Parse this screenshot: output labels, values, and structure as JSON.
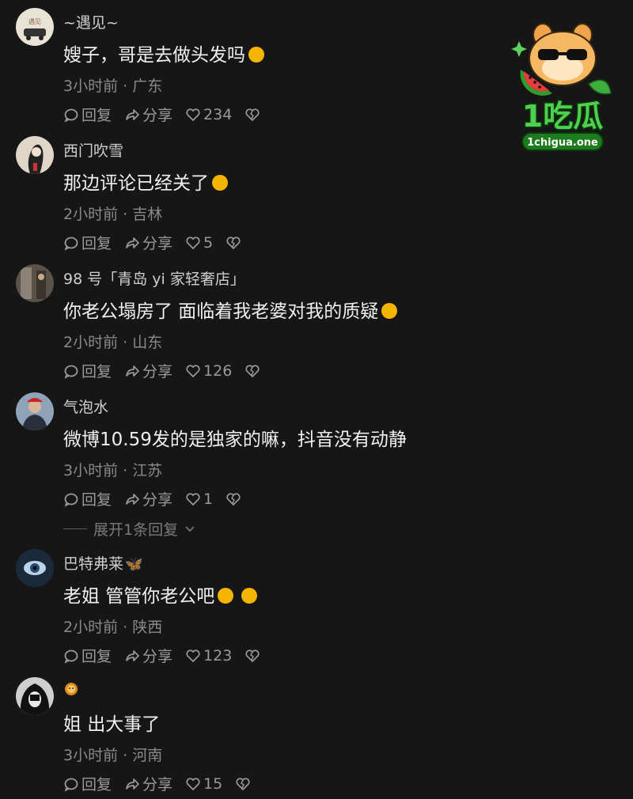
{
  "watermark": {
    "brand": "1吃瓜",
    "url": "1chigua.one"
  },
  "comments": [
    {
      "username": "~遇见~",
      "text": "嫂子，哥是去做头发吗",
      "meta": "3小时前 · 广东",
      "reply": "回复",
      "share": "分享",
      "likes": "234",
      "emoji": "laugh-cry"
    },
    {
      "username": "西门吹雪",
      "text": "那边评论已经关了",
      "meta": "2小时前 · 吉林",
      "reply": "回复",
      "share": "分享",
      "likes": "5",
      "emoji": "smile"
    },
    {
      "username": "98 号「青岛 yi 家轻奢店」",
      "text": "你老公塌房了  面临着我老婆对我的质疑",
      "meta": "2小时前 · 山东",
      "reply": "回复",
      "share": "分享",
      "likes": "126",
      "emoji": "laugh-cry"
    },
    {
      "username": "气泡水",
      "text": "微博10.59发的是独家的嘛，抖音没有动静",
      "meta": "3小时前 · 江苏",
      "reply": "回复",
      "share": "分享",
      "likes": "1",
      "emoji": ""
    },
    {
      "username": "巴特弗莱",
      "text": "老姐 管管你老公吧",
      "meta": "2小时前 · 陕西",
      "reply": "回复",
      "share": "分享",
      "likes": "123",
      "emoji": "pleading"
    },
    {
      "username": "",
      "text": "姐 出大事了",
      "meta": "3小时前 · 河南",
      "reply": "回复",
      "share": "分享",
      "likes": "15",
      "emoji": ""
    }
  ],
  "expand_replies": "展开1条回复",
  "colors": {
    "background": "#161616",
    "emoji": "#f4b400",
    "logo_green": "#2e9b2e"
  }
}
